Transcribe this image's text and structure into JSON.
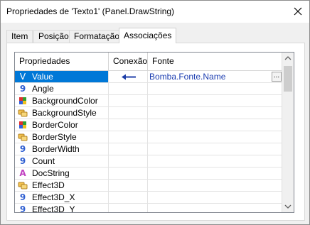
{
  "window": {
    "title": "Propriedades de 'Texto1' (Panel.DrawString)"
  },
  "tabs": [
    {
      "label": "Item",
      "active": false
    },
    {
      "label": "Posição",
      "active": false
    },
    {
      "label": "Formatação",
      "active": false
    },
    {
      "label": "Associações",
      "active": true
    }
  ],
  "grid": {
    "headers": {
      "property": "Propriedades",
      "connection": "Conexão",
      "source": "Fonte"
    },
    "rows": [
      {
        "icon": "value-icon",
        "name": "Value",
        "connected": true,
        "source": "Bomba.Fonte.Name",
        "selected": true,
        "browse_label": "..."
      },
      {
        "icon": "number-icon",
        "name": "Angle"
      },
      {
        "icon": "color-icon",
        "name": "BackgroundColor"
      },
      {
        "icon": "enum-icon",
        "name": "BackgroundStyle"
      },
      {
        "icon": "color-icon",
        "name": "BorderColor"
      },
      {
        "icon": "enum-icon",
        "name": "BorderStyle"
      },
      {
        "icon": "number-icon",
        "name": "BorderWidth"
      },
      {
        "icon": "number-icon",
        "name": "Count"
      },
      {
        "icon": "string-icon",
        "name": "DocString"
      },
      {
        "icon": "enum-icon",
        "name": "Effect3D"
      },
      {
        "icon": "number-icon",
        "name": "Effect3D_X"
      },
      {
        "icon": "number-icon",
        "name": "Effect3D_Y"
      }
    ]
  },
  "icons": {
    "number_glyph": "9",
    "string_glyph": "A",
    "value_glyph": "V"
  },
  "colors": {
    "selection": "#0078d7",
    "number_icon": "#2f5fd1",
    "string_icon": "#c040c0",
    "source_link": "#1a3cb0"
  }
}
